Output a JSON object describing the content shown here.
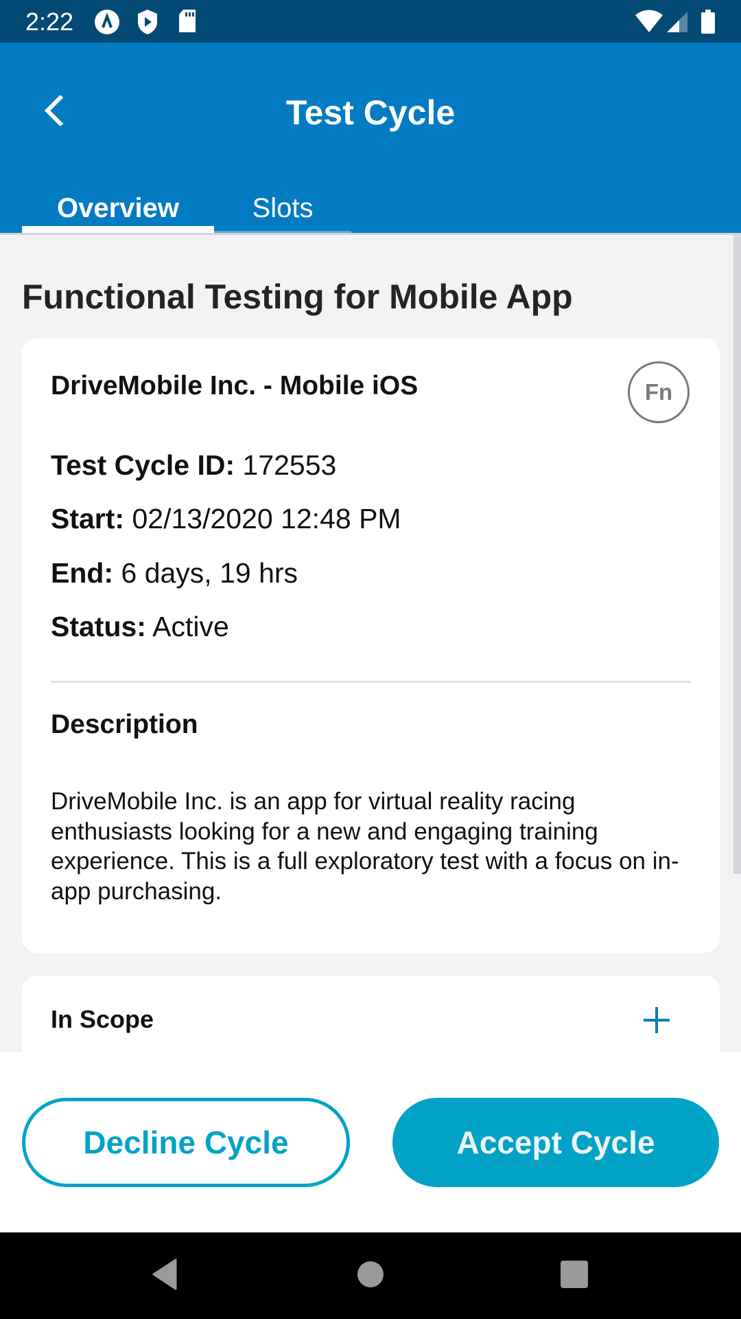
{
  "status_bar": {
    "time": "2:22",
    "left_icons": [
      "app-notification-icon",
      "shield-play-icon",
      "sd-card-icon"
    ],
    "right_icons": [
      "wifi-icon",
      "cell-signal-icon",
      "battery-icon"
    ]
  },
  "header": {
    "title": "Test Cycle",
    "back_icon": "chevron-left-icon",
    "tabs": [
      {
        "label": "Overview",
        "active": true
      },
      {
        "label": "Slots",
        "active": false
      }
    ]
  },
  "main": {
    "page_title": "Functional Testing for Mobile App",
    "card": {
      "client": "DriveMobile Inc. - Mobile iOS",
      "badge": "Fn",
      "fields": [
        {
          "label": "Test Cycle ID:",
          "value": "172553"
        },
        {
          "label": "Start:",
          "value": "02/13/2020 12:48 PM"
        },
        {
          "label": "End:",
          "value": "6 days, 19 hrs"
        },
        {
          "label": "Status:",
          "value": "Active"
        }
      ],
      "description_label": "Description",
      "description": "DriveMobile Inc. is an app for virtual reality racing enthusiasts looking for a new and engaging training experience. This is a full exploratory test with a focus on in-app purchasing."
    },
    "scope_card": {
      "label": "In Scope",
      "expand_icon": "plus-icon"
    }
  },
  "footer": {
    "decline_label": "Decline Cycle",
    "accept_label": "Accept Cycle"
  },
  "colors": {
    "status_bar": "#024a73",
    "app_bar": "#027bc3",
    "accent": "#00a3c6",
    "background": "#f2f3f5"
  },
  "nav_bar": {
    "icons": [
      "back-triangle-icon",
      "home-circle-icon",
      "recents-square-icon"
    ]
  }
}
